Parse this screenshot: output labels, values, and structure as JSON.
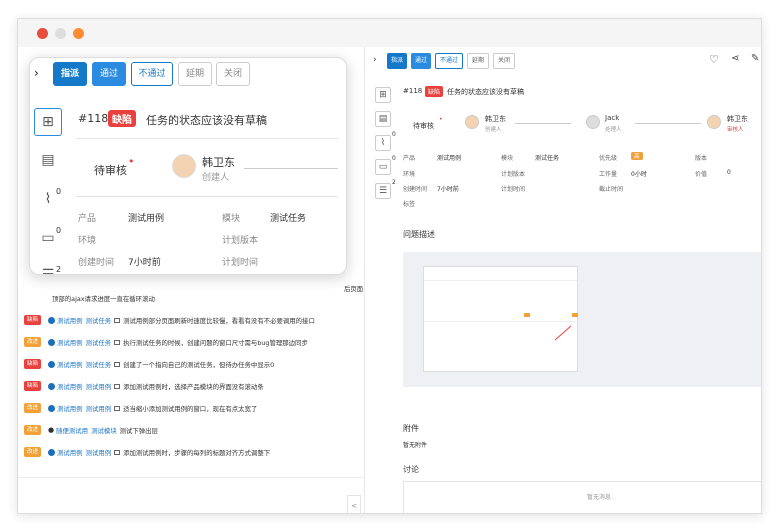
{
  "list": {
    "rows": [
      {
        "tag": "缺陷",
        "type": "bug",
        "links": [
          "测试用例",
          "测试任务"
        ],
        "text": "测试用例部分页面刷新时速度比较慢，看看有没有不必要调用的接口"
      },
      {
        "tag": "改进",
        "type": "imp",
        "links": [
          "测试用例",
          "测试任务"
        ],
        "text": "执行测试任务的时候，创建问题的窗口尺寸需与bug管理那边同步"
      },
      {
        "tag": "缺陷",
        "type": "bug",
        "links": [
          "测试用例",
          "测试任务"
        ],
        "text": "创建了一个指向自己的测试任务，但待办任务中显示0"
      },
      {
        "tag": "缺陷",
        "type": "bug",
        "links": [
          "测试用例",
          "测试用例"
        ],
        "text": "添加测试用例时，选择产品模块的界面没有滚动条"
      },
      {
        "tag": "改进",
        "type": "imp",
        "links": [
          "测试用例",
          "测试用例"
        ],
        "text": "适当缩小添加测试用例的窗口，现在有点太宽了"
      },
      {
        "tag": "改进",
        "type": "imp",
        "links": [
          "随便测试用",
          "测试模块"
        ],
        "text": "测试下弹出层"
      },
      {
        "tag": "改进",
        "type": "imp",
        "links": [
          "测试用例",
          "测试用例"
        ],
        "text": "添加测试用例时，步骤的每列的标题对齐方式调整下"
      }
    ],
    "partial_text": "顶部的ajax请求进度一直在循环滚动",
    "partial_right": "后页面",
    "pager": "<"
  },
  "detail": {
    "buttons": [
      "指派",
      "通过",
      "不通过",
      "延期",
      "关闭"
    ],
    "id": "#118",
    "type_tag": "缺陷",
    "title": "任务的状态应该没有草稿",
    "status": "待审核",
    "people": [
      {
        "name": "韩卫东",
        "role": "创建人"
      },
      {
        "name": "Jack",
        "role": "处理人"
      },
      {
        "name": "韩卫东",
        "role": "审核人"
      }
    ],
    "fields": {
      "product_label": "产品",
      "product": "测试用例",
      "module_label": "模块",
      "module": "测试任务",
      "priority_label": "优先级",
      "priority": "高",
      "version_label": "版本",
      "env_label": "环境",
      "plan_version_label": "计划版本",
      "workload_label": "工作量",
      "workload": "0小时",
      "value_label": "价值",
      "value": "0",
      "created_label": "创建时间",
      "created": "7小时前",
      "plan_time_label": "计划时间",
      "deadline_label": "截止时间",
      "tags_label": "标签"
    },
    "desc_title": "问题描述",
    "attach_title": "附件",
    "attach_empty": "暂无附件",
    "discuss_title": "讨论",
    "discuss_empty": "暂无消息",
    "side_counts": {
      "attach": "0",
      "comment": "0",
      "list": "2"
    }
  },
  "popover": {
    "buttons": [
      "指派",
      "通过",
      "不通过",
      "延期",
      "关闭"
    ],
    "id": "#118",
    "type_tag": "缺陷",
    "title": "任务的状态应该没有草稿",
    "status": "待审核",
    "creator": "韩卫东",
    "creator_role": "创建人",
    "product_label": "产品",
    "product": "测试用例",
    "module_label": "模块",
    "module": "测试任务",
    "env_label": "环境",
    "plan_version_label": "计划版本",
    "created_label": "创建时间",
    "created": "7小时前",
    "plan_time_label": "计划时间",
    "counts": {
      "attach": "0",
      "comment": "0",
      "list": "2"
    }
  }
}
